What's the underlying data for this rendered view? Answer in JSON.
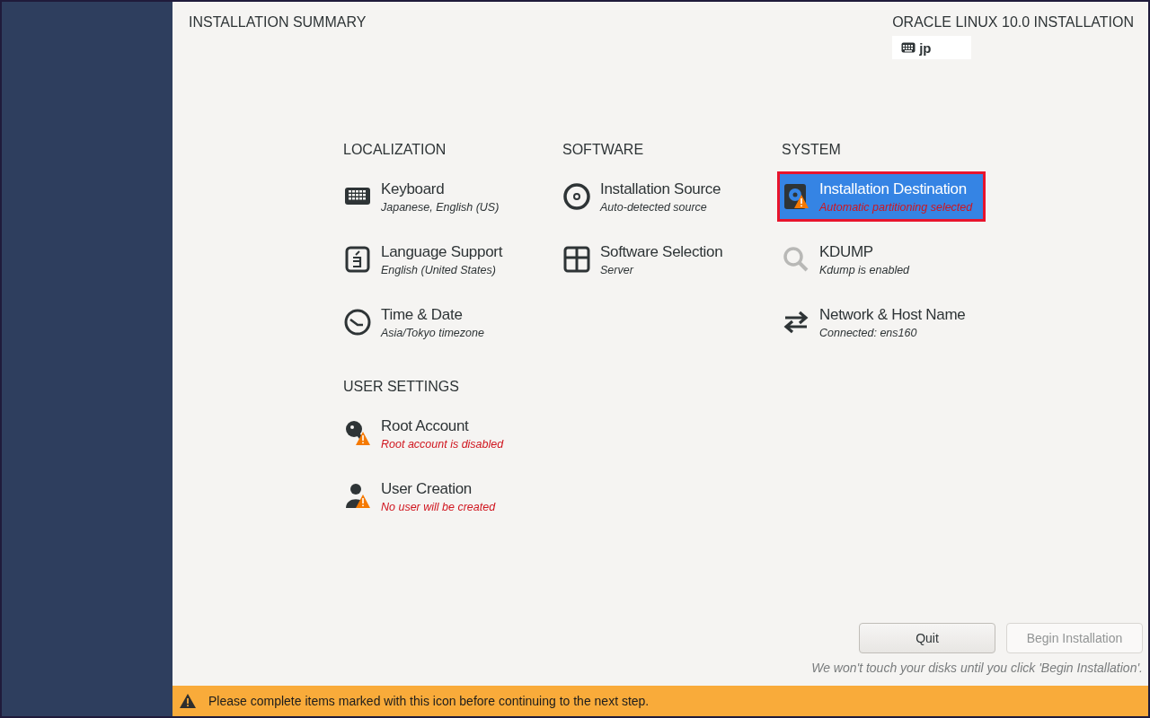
{
  "header": {
    "title": "INSTALLATION SUMMARY",
    "product": "ORACLE LINUX 10.0 INSTALLATION",
    "keyboard_layout": "jp"
  },
  "sections": [
    {
      "title": "LOCALIZATION",
      "items": [
        {
          "title": "Keyboard",
          "status": "Japanese, English (US)",
          "warning": false,
          "selected": false
        },
        {
          "title": "Language Support",
          "status": "English (United States)",
          "warning": false,
          "selected": false
        },
        {
          "title": "Time & Date",
          "status": "Asia/Tokyo timezone",
          "warning": false,
          "selected": false
        }
      ]
    },
    {
      "title": "SOFTWARE",
      "items": [
        {
          "title": "Installation Source",
          "status": "Auto-detected source",
          "warning": false,
          "selected": false
        },
        {
          "title": "Software Selection",
          "status": "Server",
          "warning": false,
          "selected": false
        }
      ]
    },
    {
      "title": "SYSTEM",
      "items": [
        {
          "title": "Installation Destination",
          "status": "Automatic partitioning selected",
          "warning": true,
          "selected": true
        },
        {
          "title": "KDUMP",
          "status": "Kdump is enabled",
          "warning": false,
          "selected": false
        },
        {
          "title": "Network & Host Name",
          "status": "Connected: ens160",
          "warning": false,
          "selected": false
        }
      ]
    },
    {
      "title": "USER SETTINGS",
      "items": [
        {
          "title": "Root Account",
          "status": "Root account is disabled",
          "warning": true,
          "selected": false
        },
        {
          "title": "User Creation",
          "status": "No user will be created",
          "warning": true,
          "selected": false
        }
      ]
    }
  ],
  "buttons": [
    {
      "label": "Quit",
      "disabled": false
    },
    {
      "label": "Begin Installation",
      "disabled": true
    }
  ],
  "note": "We won't touch your disks until you click 'Begin Installation'.",
  "warning_bar": "Please complete items marked with this icon before continuing to the next step."
}
